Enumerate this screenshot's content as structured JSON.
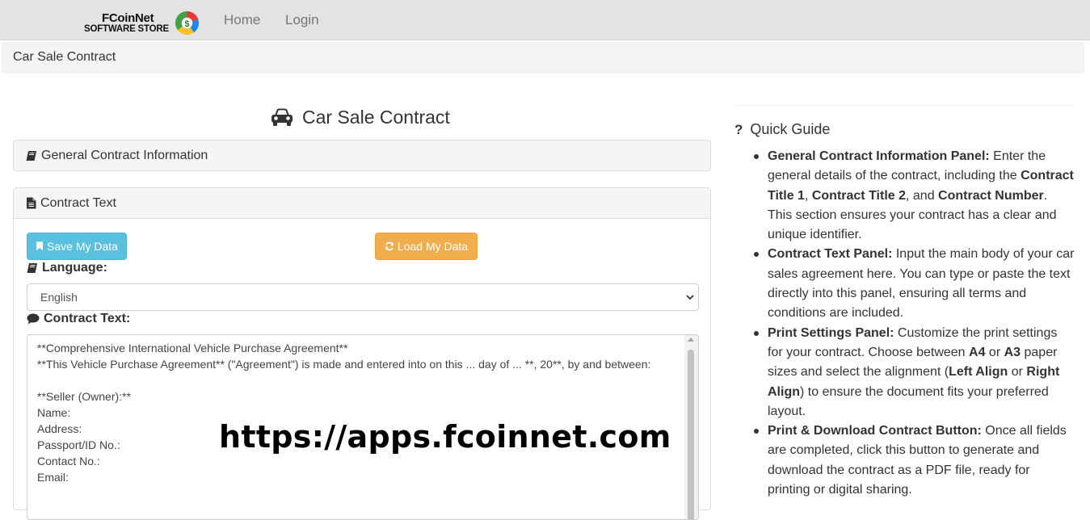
{
  "nav": {
    "brand_top": "FCoinNet",
    "brand_bottom": "SOFTWARE STORE",
    "links": [
      "Home",
      "Login"
    ]
  },
  "breadcrumb": "Car Sale Contract",
  "page_title": "Car Sale Contract",
  "panels": {
    "general": "General Contract Information",
    "contract_text": "Contract Text"
  },
  "buttons": {
    "save": "Save My Data",
    "load": "Load My Data"
  },
  "language": {
    "label": "Language:",
    "selected": "English"
  },
  "contract": {
    "label": "Contract Text:",
    "lines": [
      "**Comprehensive International Vehicle Purchase Agreement**",
      "**This Vehicle Purchase Agreement** (\"Agreement\") is made and entered into on this ... day of ... **, 20**, by and between:",
      "",
      "**Seller (Owner):**",
      "Name:",
      "Address:",
      "Passport/ID No.:",
      "Contact No.:",
      "Email:"
    ]
  },
  "watermark": "https://apps.fcoinnet.com",
  "guide": {
    "title": "Quick Guide",
    "items": [
      {
        "head": "General Contract Information Panel:",
        "t1": " Enter the general details of the contract, including the ",
        "b1": "Contract Title 1",
        "t2": ", ",
        "b2": "Contract Title 2",
        "t3": ", and ",
        "b3": "Contract Number",
        "t4": ". This section ensures your contract has a clear and unique identifier."
      },
      {
        "head": "Contract Text Panel:",
        "t1": " Input the main body of your car sales agreement here. You can type or paste the text directly into this panel, ensuring all terms and conditions are included."
      },
      {
        "head": "Print Settings Panel:",
        "t1": " Customize the print settings for your contract. Choose between ",
        "b1": "A4",
        "t2": " or ",
        "b2": "A3",
        "t3": " paper sizes and select the alignment (",
        "b3": "Left Align",
        "t4": " or ",
        "b4": "Right Align",
        "t5": ") to ensure the document fits your preferred layout."
      },
      {
        "head": "Print & Download Contract Button:",
        "t1": " Once all fields are completed, click this button to generate and download the contract as a PDF file, ready for printing or digital sharing."
      }
    ]
  }
}
